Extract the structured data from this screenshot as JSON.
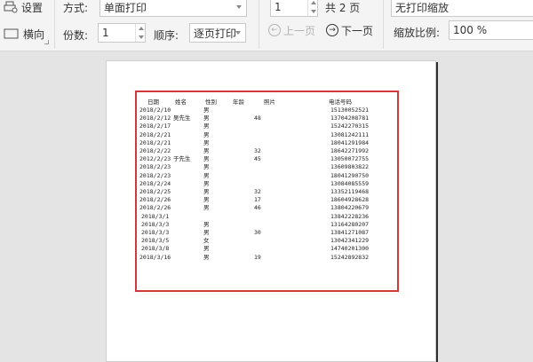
{
  "toolbar": {
    "setup_label": "设置",
    "landscape_label": "横向",
    "mode_label": "方式:",
    "mode_value": "单面打印",
    "copies_label": "份数:",
    "copies_value": "1",
    "order_label": "顺序:",
    "order_value": "逐页打印",
    "page_value": "1",
    "total_pages": "共 2 页",
    "prev_page_label": "上一页",
    "next_page_label": "下一页",
    "scale_mode_value": "无打印缩放",
    "zoom_label": "缩放比例:",
    "zoom_value": "100 %"
  },
  "sheet": {
    "headers": [
      "日期",
      "姓名",
      "性别",
      "年龄",
      "照片",
      "电话号码"
    ],
    "rows": [
      [
        "2018/2/10",
        "",
        "男",
        "",
        "",
        "15130052521"
      ],
      [
        "2018/2/12",
        "吴先生",
        "男",
        "48",
        "",
        "13704208781"
      ],
      [
        "2018/2/17",
        "",
        "男",
        "",
        "",
        "15242270315"
      ],
      [
        "2018/2/21",
        "",
        "男",
        "",
        "",
        "13081242111"
      ],
      [
        "2018/2/21",
        "",
        "男",
        "",
        "",
        "18041291984"
      ],
      [
        "2018/2/22",
        "",
        "男",
        "32",
        "",
        "18642271992"
      ],
      [
        "2012/2/23",
        "于先生",
        "男",
        "45",
        "",
        "13050072755"
      ],
      [
        "2018/2/23",
        "",
        "男",
        "",
        "",
        "13609803822"
      ],
      [
        "2018/2/23",
        "",
        "男",
        "",
        "",
        "18041290750"
      ],
      [
        "2018/2/24",
        "",
        "男",
        "",
        "",
        "13084085559"
      ],
      [
        "2018/2/25",
        "",
        "男",
        "32",
        "",
        "13352119468"
      ],
      [
        "2018/2/26",
        "",
        "男",
        "17",
        "",
        "18604928628"
      ],
      [
        "2018/2/26",
        "",
        "男",
        "46",
        "",
        "13804220679"
      ],
      [
        "2018/3/1",
        "",
        "",
        "",
        "",
        "13842228236"
      ],
      [
        "2018/3/3",
        "",
        "男",
        "",
        "",
        "13164280207"
      ],
      [
        "2018/3/3",
        "",
        "男",
        "30",
        "",
        "13841271087"
      ],
      [
        "2018/3/5",
        "",
        "女",
        "",
        "",
        "13042341229"
      ],
      [
        "2018/3/8",
        "",
        "男",
        "",
        "",
        "14740201300"
      ],
      [
        "2018/3/16",
        "",
        "男",
        "19",
        "",
        "15242892832"
      ]
    ]
  }
}
